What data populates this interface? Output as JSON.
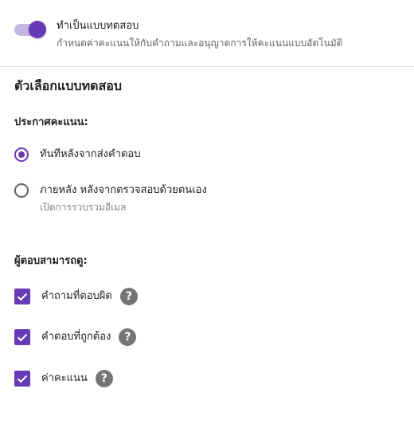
{
  "quiz": {
    "title": "ทำเป็นแบบทดสอบ",
    "description": "กำหนดค่าคะแนนให้กับคำถามและอนุญาตการให้คะแนนแบบอัตโนมัติ",
    "enabled": true
  },
  "options_section": {
    "title": "ตัวเลือกแบบทดสอบ"
  },
  "release_grade": {
    "label": "ประกาศคะแนน:",
    "options": [
      {
        "label": "ทันทีหลังจากส่งคำตอบ",
        "selected": true
      },
      {
        "label": "ภายหลัง หลังจากตรวจสอบด้วยตนเอง",
        "sublabel": "เปิดการรวบรวมอีเมล",
        "selected": false
      }
    ]
  },
  "respondent_can_see": {
    "label": "ผู้ตอบสามารถดู:",
    "items": [
      {
        "label": "คำถามที่ตอบผิด",
        "checked": true,
        "help_glyph": "?"
      },
      {
        "label": "คำตอบที่ถูกต้อง",
        "checked": true,
        "help_glyph": "?"
      },
      {
        "label": "ค่าคะแนน",
        "checked": true,
        "help_glyph": "?"
      }
    ]
  },
  "colors": {
    "accent": "#673ab7",
    "toggle_track": "#c2b7e0",
    "help_icon": "#757575"
  },
  "icons": {
    "toggle": "toggle-switch-icon",
    "radio_selected": "radio-selected-icon",
    "radio_unselected": "radio-unselected-icon",
    "checkbox": "checkbox-checked-icon",
    "help": "help-circle-icon"
  }
}
